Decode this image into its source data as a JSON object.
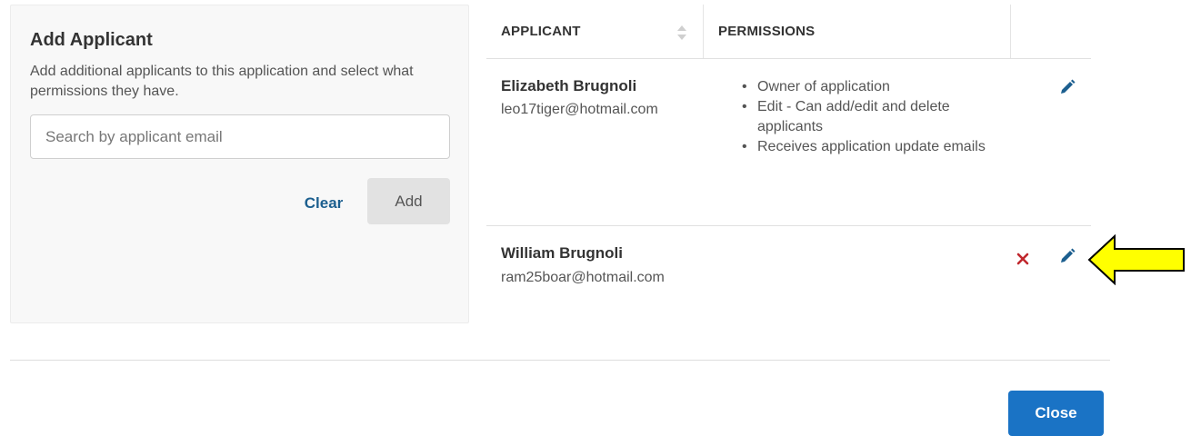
{
  "add_panel": {
    "title": "Add Applicant",
    "description": "Add additional applicants to this application and select what permissions they have.",
    "search_placeholder": "Search by applicant email",
    "search_value": "",
    "clear_label": "Clear",
    "add_label": "Add"
  },
  "table": {
    "columns": [
      "APPLICANT",
      "PERMISSIONS"
    ],
    "rows": [
      {
        "name": "Elizabeth Brugnoli",
        "email": "leo17tiger@hotmail.com",
        "permissions": [
          "Owner of application",
          "Edit - Can add/edit and delete applicants",
          "Receives application update emails"
        ]
      },
      {
        "name": "William Brugnoli",
        "email": "ram25boar@hotmail.com",
        "permissions": []
      }
    ]
  },
  "icons": {
    "edit": "pencil-icon",
    "delete": "close-x-icon",
    "sort": "sort-icon",
    "annotation": "yellow-arrow-left"
  },
  "footer": {
    "close_label": "Close"
  },
  "colors": {
    "accent": "#1a73c5",
    "link": "#1c5f8f",
    "delete": "#c0272d",
    "arrow_fill": "#ffff00"
  }
}
